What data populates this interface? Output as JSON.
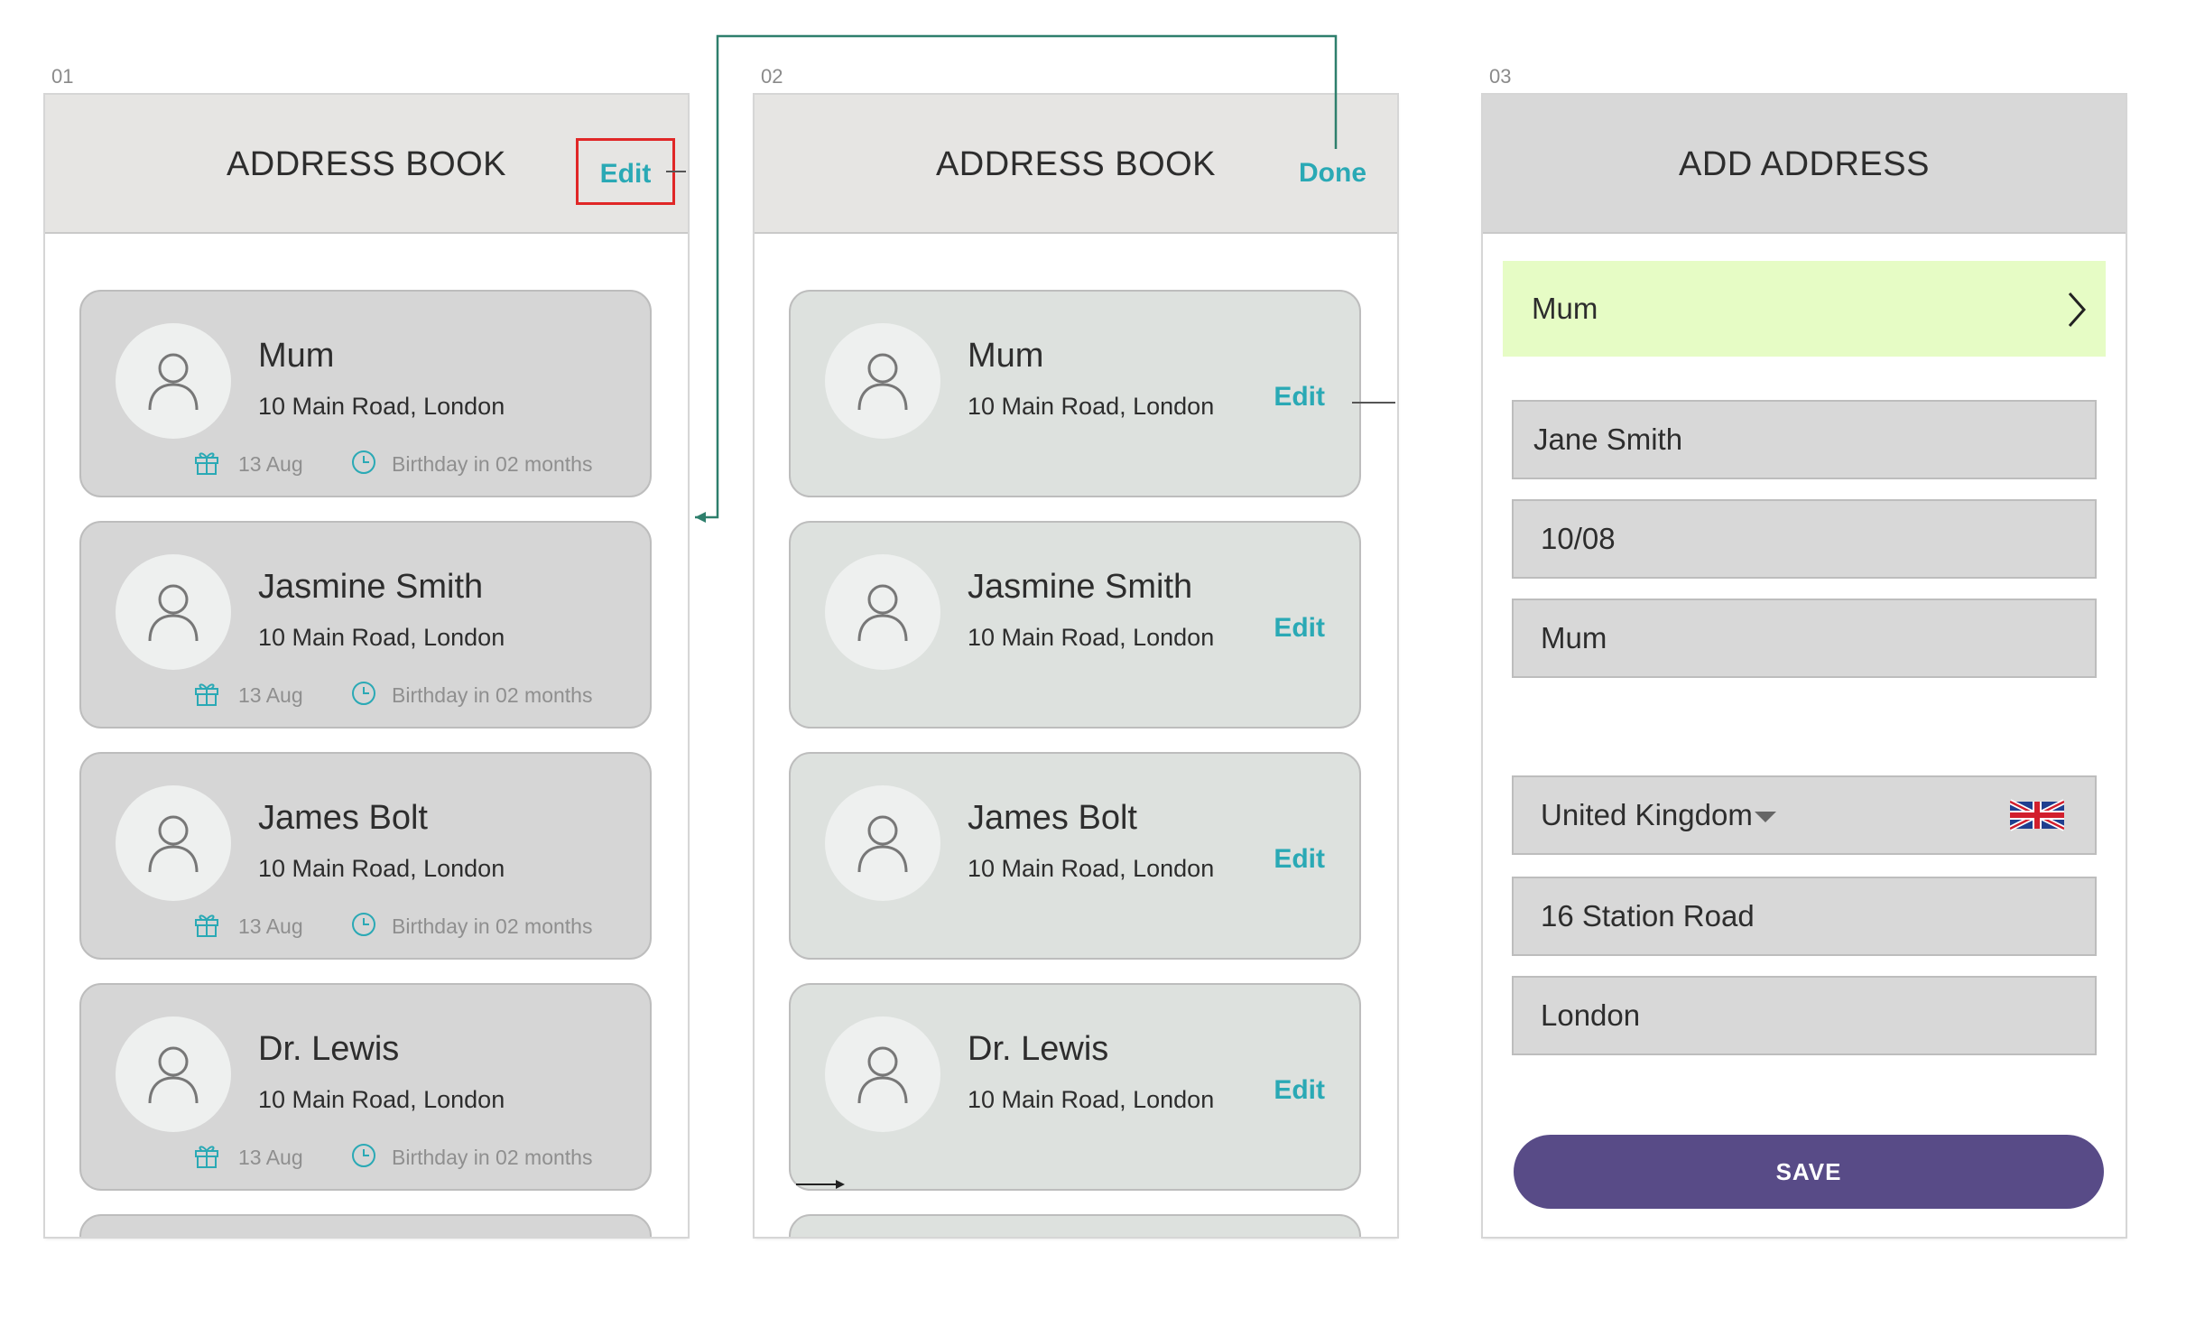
{
  "screens": [
    {
      "number": "01",
      "title": "ADDRESS BOOK",
      "action": "Edit"
    },
    {
      "number": "02",
      "title": "ADDRESS BOOK",
      "action": "Done"
    },
    {
      "number": "03",
      "title": "ADD ADDRESS"
    }
  ],
  "contacts": [
    {
      "name": "Mum",
      "address": "10 Main Road, London",
      "date": "13 Aug",
      "birthday": "Birthday in 02 months",
      "edit": "Edit"
    },
    {
      "name": "Jasmine Smith",
      "address": "10 Main Road, London",
      "date": "13 Aug",
      "birthday": "Birthday in 02 months",
      "edit": "Edit"
    },
    {
      "name": "James Bolt",
      "address": "10 Main Road, London",
      "date": "13 Aug",
      "birthday": "Birthday in 02 months",
      "edit": "Edit"
    },
    {
      "name": "Dr. Lewis",
      "address": "10 Main Road, London",
      "date": "13 Aug",
      "birthday": "Birthday in 02 months",
      "edit": "Edit"
    }
  ],
  "add_address": {
    "recipient_picker": "Mum",
    "name": "Jane Smith",
    "date": "10/08",
    "relation": "Mum",
    "country": "United Kingdom",
    "street": "16 Station Road",
    "city": "London",
    "save": "SAVE"
  },
  "colors": {
    "accent": "#2aa9b5",
    "save": "#584b87",
    "highlight": "#e6fcc5",
    "annotation": "#e02727"
  },
  "icons": [
    "avatar-icon",
    "gift-icon",
    "clock-icon",
    "chevron-right-icon",
    "uk-flag-icon"
  ]
}
